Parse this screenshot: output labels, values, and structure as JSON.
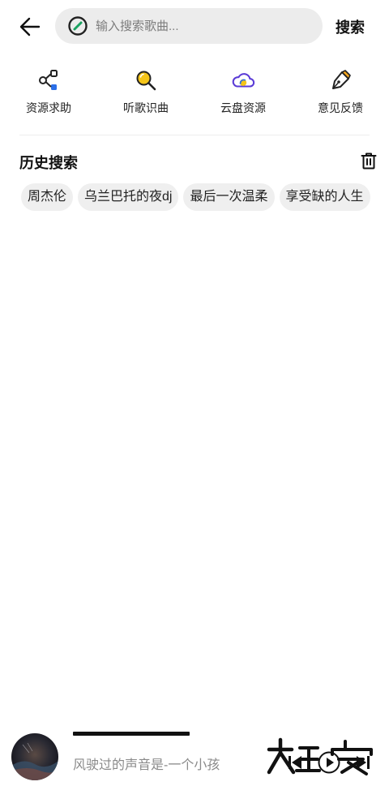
{
  "search": {
    "placeholder": "输入搜索歌曲...",
    "button_label": "搜索"
  },
  "quick_actions": [
    {
      "label": "资源求助",
      "icon": "share-nodes-icon"
    },
    {
      "label": "听歌识曲",
      "icon": "magnifier-icon"
    },
    {
      "label": "云盘资源",
      "icon": "cloud-icon"
    },
    {
      "label": "意见反馈",
      "icon": "pen-icon"
    }
  ],
  "history": {
    "title": "历史搜索",
    "tags": [
      "周杰伦",
      "乌兰巴托的夜dj",
      "最后一次温柔",
      "享受缺的人生"
    ]
  },
  "player": {
    "song": "风驶过的声音是-一个小孩",
    "progress": 0.3
  },
  "watermark": {
    "text": "大玩家"
  },
  "colors": {
    "accent_blue": "#2b6fe8",
    "accent_orange": "#f4a51c",
    "accent_yellow": "#f5c518",
    "logo_green": "#1aa260",
    "icon_stroke": "#222222"
  }
}
